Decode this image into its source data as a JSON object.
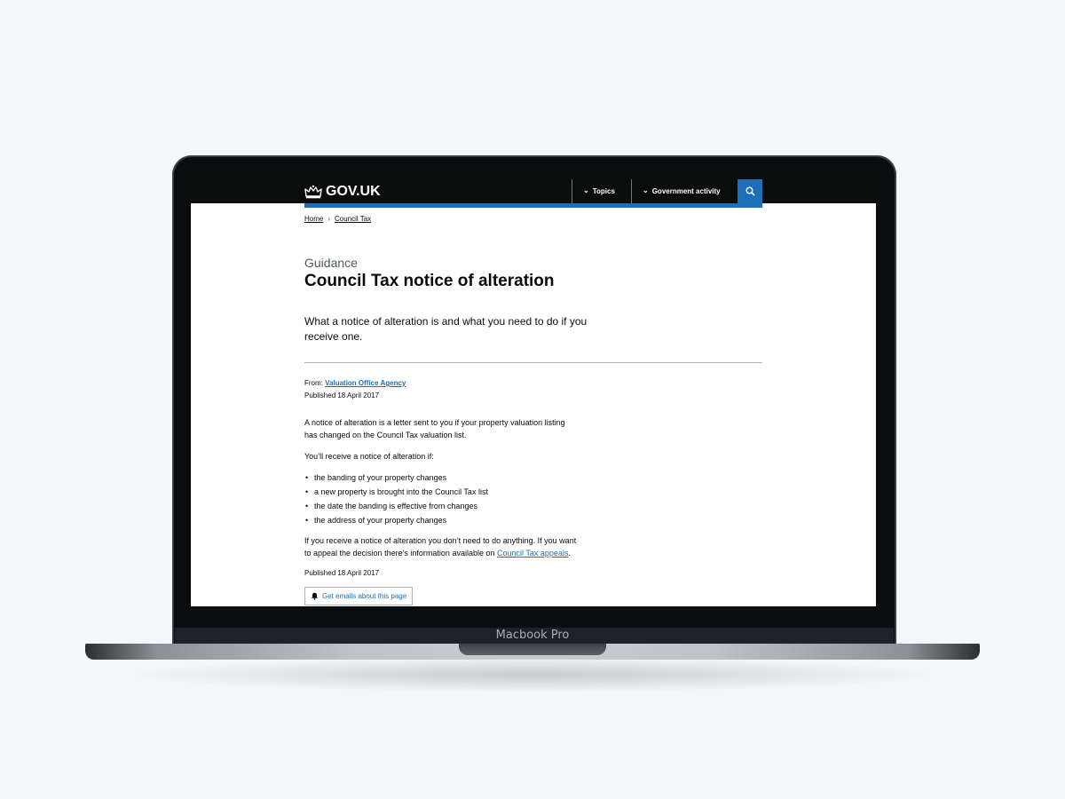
{
  "device": {
    "label": "Macbook Pro"
  },
  "header": {
    "logo_text": "GOV.UK",
    "nav": [
      {
        "label": "Topics"
      },
      {
        "label": "Government activity"
      }
    ],
    "search_icon": "search-icon",
    "colors": {
      "bar": "#0b0c0c",
      "accent": "#1d70b8"
    }
  },
  "breadcrumb": [
    {
      "label": "Home"
    },
    {
      "label": "Council Tax"
    }
  ],
  "page": {
    "caption": "Guidance",
    "title": "Council Tax notice of alteration",
    "lead_1": "What a notice of alteration is and what you need to do if you",
    "lead_2": "receive one.",
    "from_label": "From:",
    "from_org": "Valuation Office Agency",
    "published": "Published 18 April 2017",
    "para1_line1": "A notice of alteration is a letter sent to you if your property valuation listing",
    "para1_line2": "has changed on the Council Tax valuation list.",
    "para2": "You’ll receive a notice of alteration if:",
    "bullets": [
      "the banding of your property changes",
      "a new property is brought into the Council Tax list",
      "the date the banding is effective from changes",
      "the address of your property changes"
    ],
    "para3_line1": "If you receive a notice of alteration you don’t need to do anything. If you want",
    "para3_line2_prefix": "to appeal the decision there’s information available on",
    "para3_link": "Council Tax appeals",
    "para3_suffix": ".",
    "published_footer": "Published 18 April 2017",
    "email_button": "Get emails about this page"
  }
}
